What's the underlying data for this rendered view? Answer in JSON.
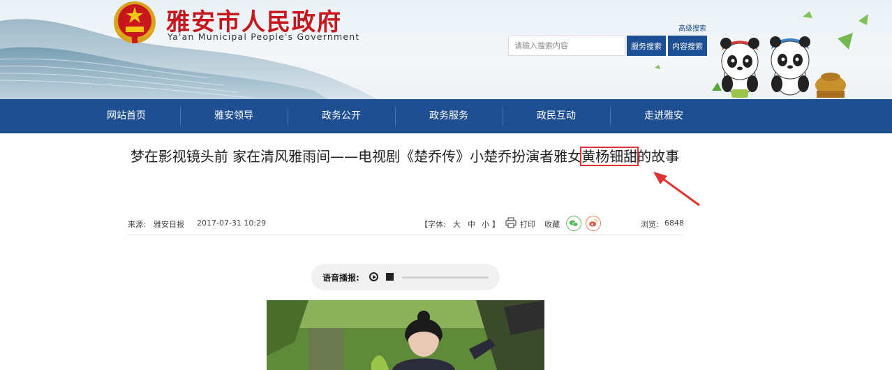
{
  "header": {
    "site_title": "雅安市人民政府",
    "site_subtitle": "Ya'an Municipal People's Government",
    "advanced_search": "高级搜索",
    "search_placeholder": "请输入搜索内容",
    "service_search": "服务搜索",
    "content_search": "内容搜索"
  },
  "nav": {
    "items": [
      "网站首页",
      "雅安领导",
      "政务公开",
      "政务服务",
      "政民互动",
      "走进雅安"
    ]
  },
  "article": {
    "headline_before": "梦在影视镜头前 家在清风雅雨间——电视剧《楚乔传》小楚乔扮演者雅女",
    "headline_highlight": "黄杨钿甜",
    "headline_after": "的故事",
    "source_label": "来源:",
    "source": "雅安日报",
    "date": "2017-07-31 10:29",
    "font_label": "【字体:",
    "font_large": "大",
    "font_medium": "中",
    "font_small": "小",
    "font_close": "】",
    "print": "打印",
    "favorite": "收藏",
    "views_label": "浏览:",
    "views": "6848"
  },
  "player": {
    "label": "语音播报:",
    "progress": 0
  },
  "colors": {
    "brand_red": "#c8161d",
    "nav_blue": "#1f4f93",
    "highlight_red": "#e0322f"
  },
  "icons": [
    "national-emblem",
    "print-icon",
    "wechat-icon",
    "weibo-icon",
    "play-icon",
    "stop-icon",
    "annotation-arrow"
  ]
}
